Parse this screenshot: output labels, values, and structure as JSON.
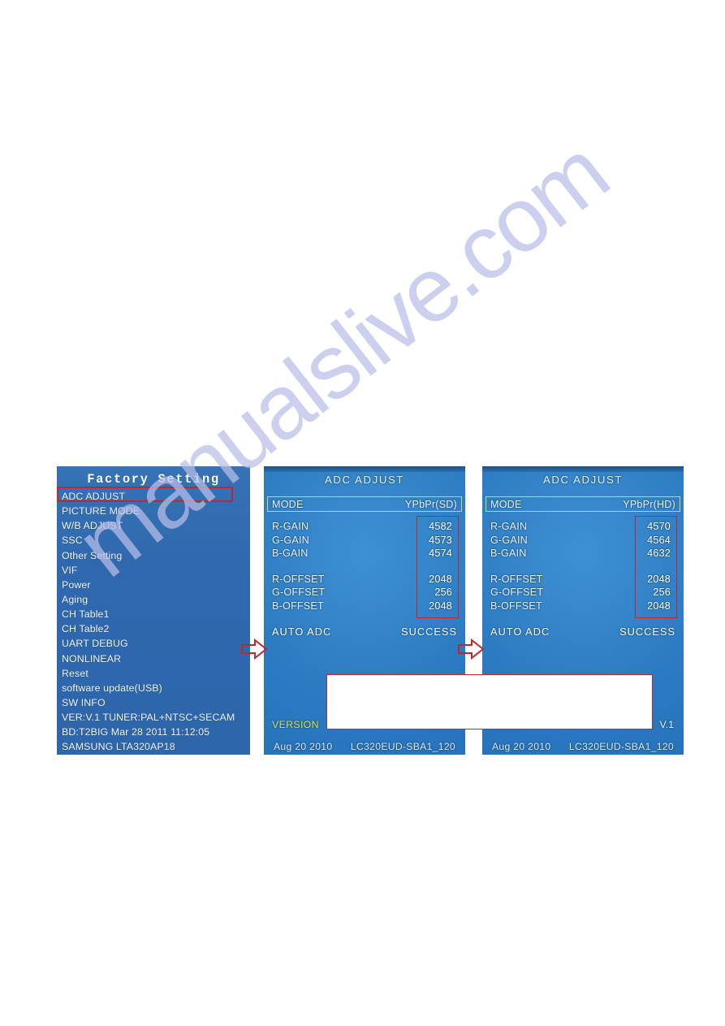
{
  "colors": {
    "osd_blue": "#2c7bc2",
    "menu_blue": "#2f68ae",
    "callout_red": "#c0262c",
    "mode_border": "#c9d86a",
    "version_yellow": "#d9e24a",
    "watermark": "#b9bfe8"
  },
  "watermark": {
    "text": "manualslive.com"
  },
  "factory_setting_panel": {
    "title": "Factory Setting",
    "selected_item": "ADC ADJUST",
    "items": [
      "ADC ADJUST",
      "PICTURE MODE",
      "W/B ADJUST",
      "SSC",
      "Other Setting",
      "VIF",
      "Power",
      "Aging",
      "CH Table1",
      "CH Table2",
      "UART DEBUG",
      "NONLINEAR",
      "Reset",
      "software update(USB)",
      "SW INFO",
      "VER:V.1 TUNER:PAL+NTSC+SECAM",
      "BD:T2BIG Mar 28 2011 11:12:05",
      "SAMSUNG LTA320AP18"
    ]
  },
  "adc_panel_sd": {
    "title": "ADC  ADJUST",
    "mode_label": "MODE",
    "mode_value": "YPbPr(SD)",
    "rows": [
      {
        "label": "R-GAIN",
        "value": "4582"
      },
      {
        "label": "G-GAIN",
        "value": "4573"
      },
      {
        "label": "B-GAIN",
        "value": "4574"
      }
    ],
    "offset_rows": [
      {
        "label": "R-OFFSET",
        "value": "2048"
      },
      {
        "label": "G-OFFSET",
        "value": "256"
      },
      {
        "label": "B-OFFSET",
        "value": "2048"
      }
    ],
    "auto_adc_label": "AUTO  ADC",
    "auto_adc_value": "SUCCESS",
    "version_label": "VERSION",
    "version_value": "",
    "footer_date": "Aug 20  2010",
    "footer_model": "LC320EUD-SBA1_120"
  },
  "adc_panel_hd": {
    "title": "ADC  ADJUST",
    "mode_label": "MODE",
    "mode_value": "YPbPr(HD)",
    "rows": [
      {
        "label": "R-GAIN",
        "value": "4570"
      },
      {
        "label": "G-GAIN",
        "value": "4564"
      },
      {
        "label": "B-GAIN",
        "value": "4632"
      }
    ],
    "offset_rows": [
      {
        "label": "R-OFFSET",
        "value": "2048"
      },
      {
        "label": "G-OFFSET",
        "value": "256"
      },
      {
        "label": "B-OFFSET",
        "value": "2048"
      }
    ],
    "auto_adc_label": "AUTO  ADC",
    "auto_adc_value": "SUCCESS",
    "version_label": "",
    "version_value": "V.1",
    "footer_date": "Aug 20  2010",
    "footer_model": "LC320EUD-SBA1_120"
  }
}
